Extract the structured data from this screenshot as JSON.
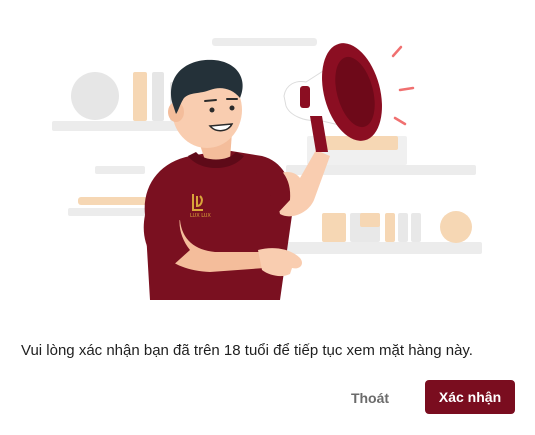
{
  "dialog": {
    "message": "Vui lòng xác nhận bạn đã trên 18 tuổi để tiếp tục xem mặt hàng này.",
    "cancel_label": "Thoát",
    "confirm_label": "Xác nhận"
  },
  "illustration": {
    "icon": "man-with-megaphone-illustration",
    "shirt_logo_text": "LUX LUX"
  },
  "colors": {
    "brand": "#7a0d1f",
    "shirt": "#7a1020",
    "skin": "#f9cdb0",
    "shelf_gray": "#ececec",
    "accent_orange": "#f6d7b4",
    "megaphone_red": "#8b0e22"
  }
}
